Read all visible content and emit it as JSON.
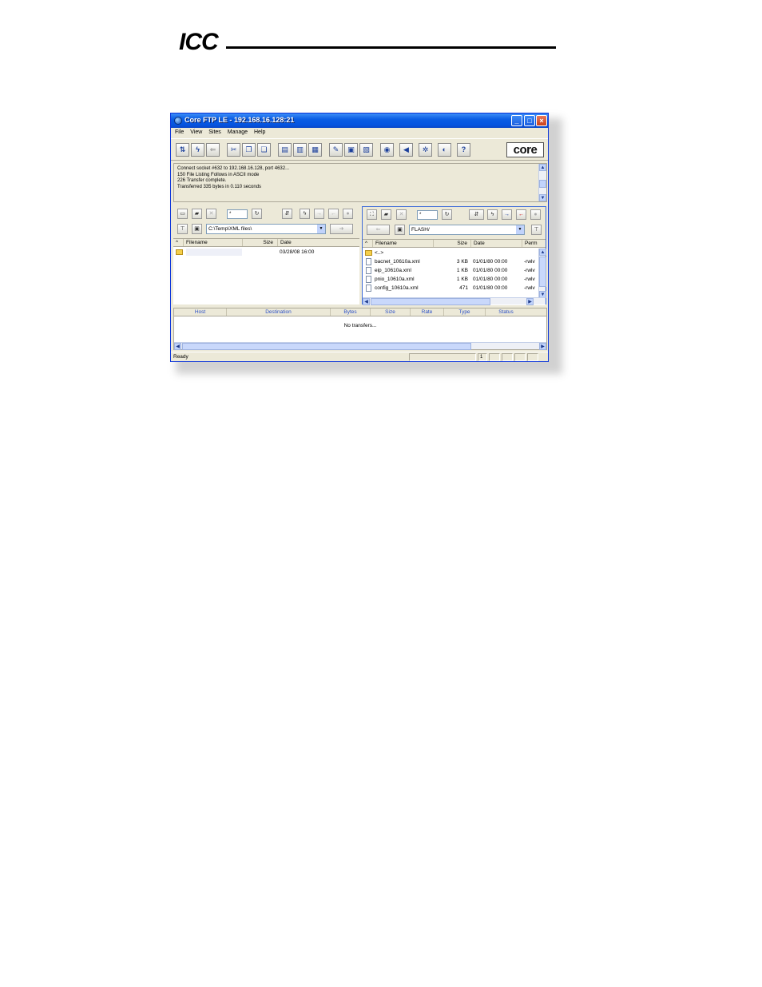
{
  "page": {
    "logo": "ICC"
  },
  "window": {
    "title": "Core FTP LE - 192.168.16.128:21",
    "controls": {
      "minimize": "_",
      "maximize": "□",
      "close": "×"
    },
    "menu": [
      "File",
      "View",
      "Sites",
      "Manage",
      "Help"
    ],
    "toolbar": {
      "buttons": [
        "connect-icon",
        "quick-connect-icon",
        "disconnect-icon",
        "cut-icon",
        "copy-icon",
        "paste-icon",
        "view-icon",
        "edit-icon",
        "properties-icon",
        "tools-icon",
        "site-manager-icon",
        "queue-icon",
        "eye-icon",
        "sound-icon",
        "settings-icon",
        "about-icon",
        "help-icon"
      ],
      "brand": "core"
    },
    "log": [
      "Connect socket #632 to 192.168.16.128, port 4632...",
      "150 File Listing Follows in ASCII mode",
      "226 Transfer complete.",
      "Transferred 335 bytes in 0.110 seconds"
    ],
    "local": {
      "filter": "*",
      "path": "C:\\Temp\\XML files\\",
      "columns": [
        "Filename",
        "Size",
        "Date"
      ],
      "rows": [
        {
          "name": "",
          "size": "",
          "date": "03/28/08 16:00"
        }
      ]
    },
    "remote": {
      "filter": "*",
      "path": "FLASH/",
      "columns": [
        "Filename",
        "Size",
        "Date",
        "Perm"
      ],
      "rows": [
        {
          "name": "<..>",
          "size": "",
          "date": "",
          "perm": ""
        },
        {
          "name": "bacnet_10610a.xml",
          "size": "3 KB",
          "date": "01/01/80  00:00",
          "perm": "-rwlv"
        },
        {
          "name": "eip_10610a.xml",
          "size": "1 KB",
          "date": "01/01/80  00:00",
          "perm": "-rwlv"
        },
        {
          "name": "pnio_10610a.xml",
          "size": "1 KB",
          "date": "01/01/80  00:00",
          "perm": "-rwlv"
        },
        {
          "name": "config_10610a.xml",
          "size": "471",
          "date": "01/01/80  00:00",
          "perm": "-rwlv"
        }
      ]
    },
    "queue": {
      "columns": [
        "Host",
        "Destination",
        "Bytes",
        "Size",
        "Rate",
        "Type",
        "Status"
      ],
      "empty": "No transfers..."
    },
    "status": {
      "text": "Ready",
      "cell": "1"
    }
  }
}
